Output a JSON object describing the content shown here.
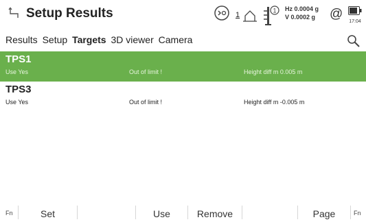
{
  "header": {
    "title": "Setup Results",
    "face": "1",
    "hz": "Hz 0.0004 g",
    "v": "V  0.0002 g",
    "time": "17:04"
  },
  "tabs": [
    "Results",
    "Setup",
    "Targets",
    "3D viewer",
    "Camera"
  ],
  "active_tab": "Targets",
  "targets": [
    {
      "name": "TPS1",
      "use": "Use  Yes",
      "out_of_limit": "Out of limit  !",
      "height_diff": "Height diff m  0.005 m",
      "selected": true
    },
    {
      "name": "TPS3",
      "use": "Use  Yes",
      "out_of_limit": "Out of limit  !",
      "height_diff": "Height diff m  -0.005 m",
      "selected": false
    }
  ],
  "softkeys": {
    "fn_left": "Fn",
    "set": "Set",
    "use": "Use",
    "remove": "Remove",
    "page": "Page",
    "fn_right": "Fn"
  },
  "colors": {
    "selected_row": "#6ab04c"
  }
}
